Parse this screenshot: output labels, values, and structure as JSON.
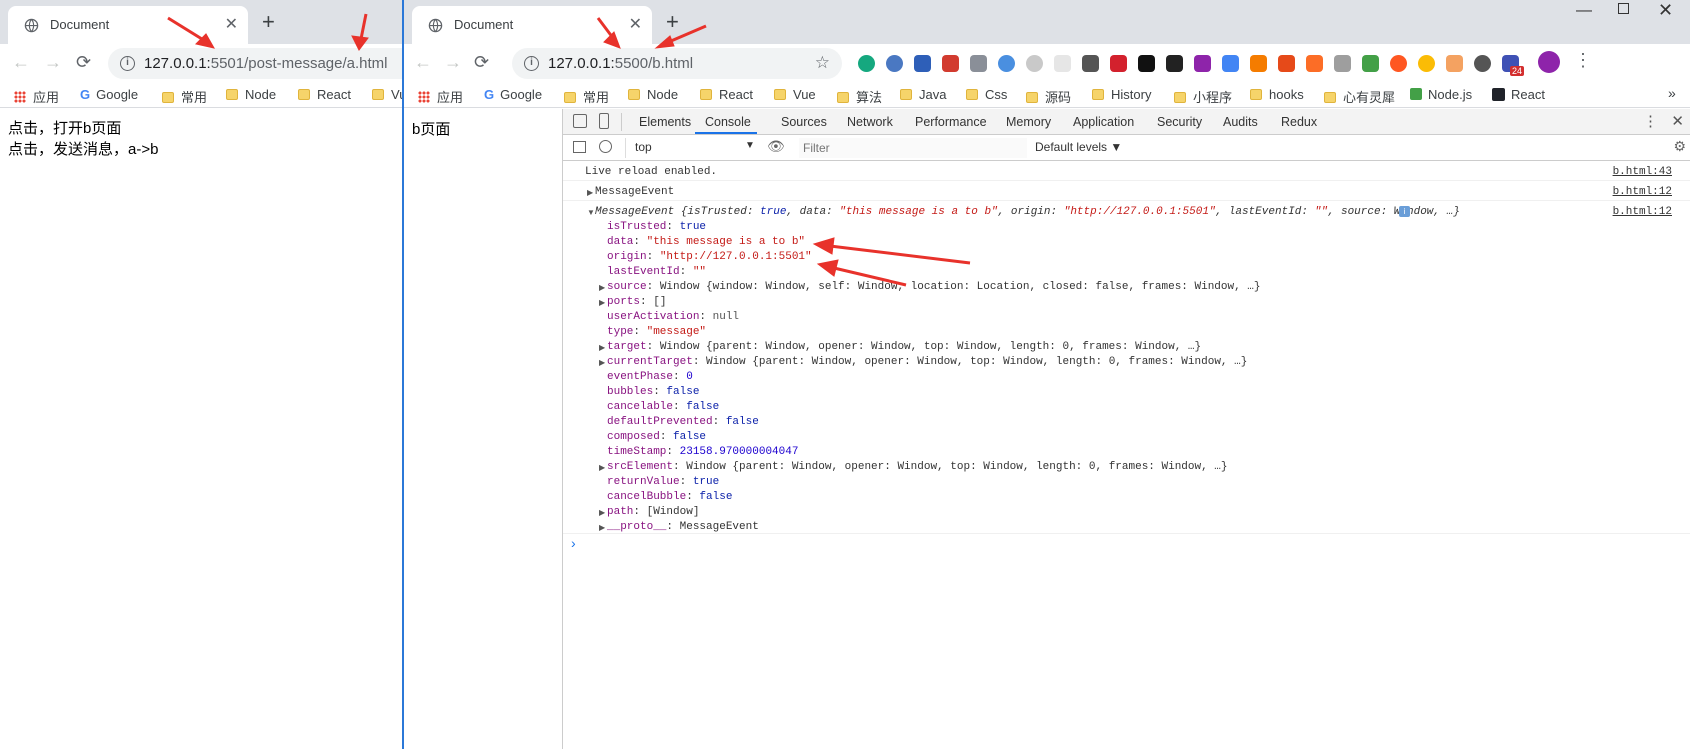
{
  "windowA": {
    "tab_title": "Document",
    "url_host": "127.0.0.1:",
    "url_rest": "5501/post-message/a.html",
    "bookmarks": [
      "应用",
      "Google",
      "常用",
      "Node",
      "React",
      "Vu"
    ],
    "page_lines": [
      "点击，打开b页面",
      "点击，发送消息，a->b"
    ]
  },
  "windowB": {
    "tab_title": "Document",
    "url_host": "127.0.0.1:",
    "url_rest": "5500/b.html",
    "bookmarks": [
      "应用",
      "Google",
      "常用",
      "Node",
      "React",
      "Vue",
      "算法",
      "Java",
      "Css",
      "源码",
      "History",
      "小程序",
      "hooks",
      "心有灵犀",
      "Node.js",
      "React"
    ],
    "page_text": "b页面",
    "ext_badge": "24"
  },
  "devtools": {
    "tabs": [
      "Elements",
      "Console",
      "Sources",
      "Network",
      "Performance",
      "Memory",
      "Application",
      "Security",
      "Audits",
      "Redux"
    ],
    "context": "top",
    "filter_placeholder": "Filter",
    "levels": "Default levels ▼",
    "log1": {
      "text": "Live reload enabled.",
      "src": "b.html:43"
    },
    "log2": {
      "text": "MessageEvent",
      "src": "b.html:12"
    },
    "log3_src": "b.html:12",
    "summary": {
      "head": "MessageEvent {",
      "isTrusted_k": "isTrusted: ",
      "isTrusted_v": "true",
      "data_k": ", data: ",
      "data_v": "\"this message is a to b\"",
      "origin_k": ", origin: ",
      "origin_v": "\"http://127.0.0.1:5501\"",
      "lei_k": ", lastEventId: ",
      "lei_v": "\"\"",
      "source_k": ", source: ",
      "tail": "Window, …}"
    },
    "props": [
      {
        "key": "isTrusted",
        "val": "true",
        "type": "kw",
        "expand": false
      },
      {
        "key": "data",
        "val": "\"this message is a to b\"",
        "type": "s",
        "expand": false
      },
      {
        "key": "origin",
        "val": "\"http://127.0.0.1:5501\"",
        "type": "s",
        "expand": false
      },
      {
        "key": "lastEventId",
        "val": "\"\"",
        "type": "s",
        "expand": false
      },
      {
        "key": "source",
        "val": "Window {window: Window, self: Window, location: Location, closed: false, frames: Window, …}",
        "type": "o",
        "expand": true
      },
      {
        "key": "ports",
        "val": "[]",
        "type": "o",
        "expand": true
      },
      {
        "key": "userActivation",
        "val": "null",
        "type": "g",
        "expand": false
      },
      {
        "key": "type",
        "val": "\"message\"",
        "type": "s",
        "expand": false
      },
      {
        "key": "target",
        "val": "Window {parent: Window, opener: Window, top: Window, length: 0, frames: Window, …}",
        "type": "o",
        "expand": true
      },
      {
        "key": "currentTarget",
        "val": "Window {parent: Window, opener: Window, top: Window, length: 0, frames: Window, …}",
        "type": "o",
        "expand": true
      },
      {
        "key": "eventPhase",
        "val": "0",
        "type": "n",
        "expand": false
      },
      {
        "key": "bubbles",
        "val": "false",
        "type": "kw",
        "expand": false
      },
      {
        "key": "cancelable",
        "val": "false",
        "type": "kw",
        "expand": false
      },
      {
        "key": "defaultPrevented",
        "val": "false",
        "type": "kw",
        "expand": false
      },
      {
        "key": "composed",
        "val": "false",
        "type": "kw",
        "expand": false
      },
      {
        "key": "timeStamp",
        "val": "23158.970000004047",
        "type": "n",
        "expand": false
      },
      {
        "key": "srcElement",
        "val": "Window {parent: Window, opener: Window, top: Window, length: 0, frames: Window, …}",
        "type": "o",
        "expand": true
      },
      {
        "key": "returnValue",
        "val": "true",
        "type": "kw",
        "expand": false
      },
      {
        "key": "cancelBubble",
        "val": "false",
        "type": "kw",
        "expand": false
      },
      {
        "key": "path",
        "val": "[Window]",
        "type": "o",
        "expand": true
      },
      {
        "key": "__proto__",
        "val": "MessageEvent",
        "type": "o",
        "expand": true
      }
    ],
    "prompt": "›"
  },
  "colors": {
    "accent": "#1a73e8",
    "annotation": "#e8322b"
  }
}
